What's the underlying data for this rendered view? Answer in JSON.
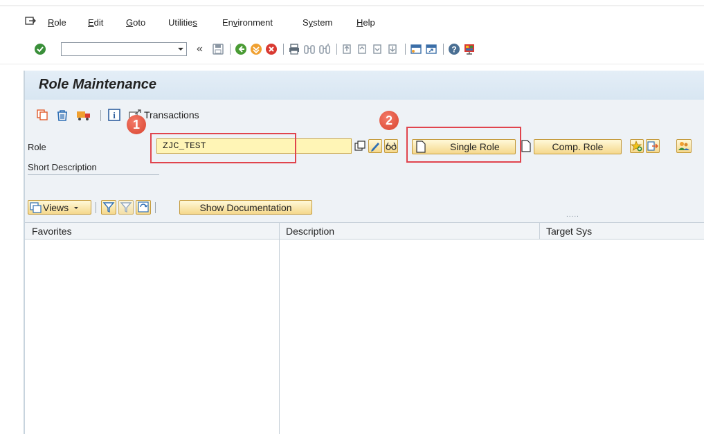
{
  "menu": {
    "items": [
      {
        "label": "Role",
        "accel": "R",
        "rest": "ole"
      },
      {
        "label": "Edit",
        "accel": "E",
        "rest": "dit"
      },
      {
        "label": "Goto",
        "accel": "G",
        "rest": "oto"
      },
      {
        "label": "Utilities",
        "pre": "Utilitie",
        "accel": "s",
        "post": ""
      },
      {
        "label": "Environment",
        "pre": "En",
        "accel": "v",
        "post": "ironment"
      },
      {
        "label": "System",
        "pre": "S",
        "accel": "y",
        "post": "stem"
      },
      {
        "label": "Help",
        "accel": "H",
        "rest": "elp"
      }
    ]
  },
  "toolbar": {
    "command_value": "",
    "back_glyph": "«"
  },
  "screen": {
    "title": "Role Maintenance",
    "transactions_label": "Transactions"
  },
  "form": {
    "role_label": "Role",
    "role_value": "ZJC_TEST",
    "short_desc_label": "Short Description",
    "single_role_label": "Single Role",
    "comp_role_label": "Comp. Role"
  },
  "list_toolbar": {
    "views_label": "Views",
    "show_doc_label": "Show Documentation",
    "dots": "....."
  },
  "table": {
    "columns": [
      "Favorites",
      "Description",
      "Target Sys"
    ]
  },
  "annotations": {
    "badge1": "1",
    "badge2": "2"
  },
  "colors": {
    "highlight": "#e0444d",
    "button_fill": "#f5d88c",
    "title_bar": "#d8e6f2",
    "field_yellow": "#fff5b6"
  }
}
